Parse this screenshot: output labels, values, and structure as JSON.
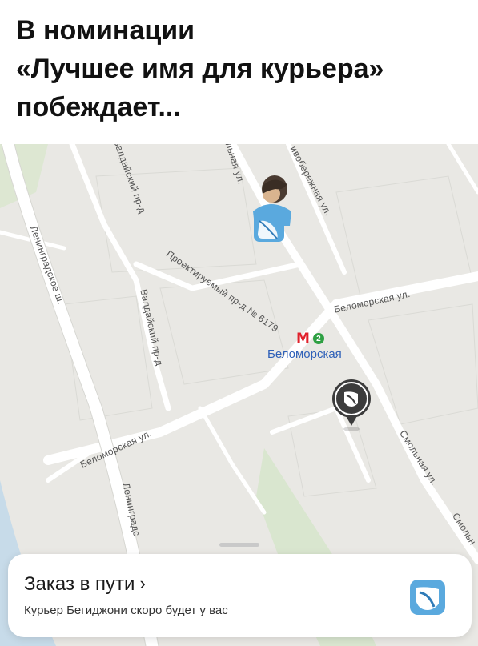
{
  "caption": {
    "line1": "В номинации",
    "line2": "«Лучшее имя для курьера»",
    "line3": "побеждает..."
  },
  "map": {
    "streets": {
      "valdaysky_top": "Валдайский пр-д",
      "valdaysky_mid": "Валдайский пр-д",
      "leningradskoe_top": "Ленинградское ш.",
      "leningradskoe_bottom": "Ленинградс",
      "proektiruemy": "Проектируемый пр-д № 6179",
      "belomorskaya_right": "Беломорская ул.",
      "belomorskaya_left": "Беломорская ул.",
      "smolnaya_top": "льная ул.",
      "smolnaya_mid": "Смольная ул.",
      "smolnaya_edge": "Смольн",
      "naberezhnaya": "ивобережная ул."
    },
    "metro": {
      "logo": "М",
      "line_number": "2",
      "station": "Беломорская",
      "logo_color": "#e0212b",
      "line_color": "#2ea043"
    }
  },
  "sheet": {
    "title": "Заказ в пути",
    "chevron": "›",
    "subtitle": "Курьер Бегиджони скоро будет у вас",
    "icon": "courier-app-icon"
  },
  "colors": {
    "map_bg": "#e9e8e4",
    "road": "#ffffff",
    "water": "#c7dbe9",
    "park": "#d9e6cf",
    "brand_blue": "#5aa9de"
  }
}
